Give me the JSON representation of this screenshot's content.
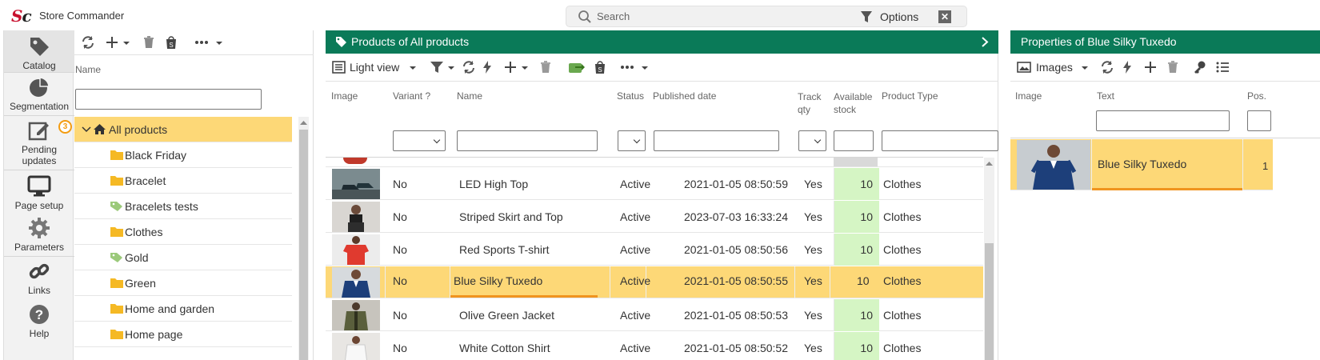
{
  "app": {
    "logo_s": "S",
    "logo_c": "c",
    "title": "Store Commander"
  },
  "search": {
    "placeholder": "Search",
    "options_label": "Options",
    "close_glyph": "✕"
  },
  "nav": {
    "items": [
      {
        "label": "Catalog",
        "icon": "tag-icon"
      },
      {
        "label": "Segmentation",
        "icon": "pie-chart-icon"
      },
      {
        "label": "Pending updates",
        "line1": "Pending",
        "line2": "updates",
        "icon": "edit-icon",
        "badge": "3"
      },
      {
        "label": "Page setup",
        "icon": "monitor-icon"
      },
      {
        "label": "Parameters",
        "icon": "gear-icon"
      },
      {
        "label": "Links",
        "icon": "link-icon"
      },
      {
        "label": "Help",
        "icon": "help-icon"
      }
    ]
  },
  "categories": {
    "column_header": "Name",
    "root": "All products",
    "items": [
      {
        "label": "Black Friday",
        "icon": "folder-icon"
      },
      {
        "label": "Bracelet",
        "icon": "folder-icon"
      },
      {
        "label": "Bracelets tests",
        "icon": "tag-icon"
      },
      {
        "label": "Clothes",
        "icon": "folder-icon"
      },
      {
        "label": "Gold",
        "icon": "tag-icon"
      },
      {
        "label": "Green",
        "icon": "folder-icon"
      },
      {
        "label": "Home and garden",
        "icon": "folder-icon"
      },
      {
        "label": "Home page",
        "icon": "folder-icon"
      }
    ]
  },
  "products": {
    "title": "Products of All products",
    "view_label": "Light view",
    "columns": {
      "image": "Image",
      "variant": "Variant ?",
      "name": "Name",
      "status": "Status",
      "published": "Published date",
      "track_l1": "Track",
      "track_l2": "qty",
      "stock_l1": "Available",
      "stock_l2": "stock",
      "type": "Product Type"
    },
    "rows": [
      {
        "variant": "No",
        "name": "LED High Top",
        "status": "Active",
        "published": "2021-01-05 08:50:59",
        "track": "Yes",
        "stock": "10",
        "type": "Clothes",
        "selected": false
      },
      {
        "variant": "No",
        "name": "Striped Skirt and Top",
        "status": "Active",
        "published": "2023-07-03 16:33:24",
        "track": "Yes",
        "stock": "10",
        "type": "Clothes",
        "selected": false
      },
      {
        "variant": "No",
        "name": "Red Sports T-shirt",
        "status": "Active",
        "published": "2021-01-05 08:50:56",
        "track": "Yes",
        "stock": "10",
        "type": "Clothes",
        "selected": false
      },
      {
        "variant": "No",
        "name": "Blue Silky Tuxedo",
        "status": "Active",
        "published": "2021-01-05 08:50:55",
        "track": "Yes",
        "stock": "10",
        "type": "Clothes",
        "selected": true
      },
      {
        "variant": "No",
        "name": "Olive Green Jacket",
        "status": "Active",
        "published": "2021-01-05 08:50:53",
        "track": "Yes",
        "stock": "10",
        "type": "Clothes",
        "selected": false
      },
      {
        "variant": "No",
        "name": "White Cotton Shirt",
        "status": "Active",
        "published": "2021-01-05 08:50:52",
        "track": "Yes",
        "stock": "10",
        "type": "Clothes",
        "selected": false
      }
    ]
  },
  "properties": {
    "title": "Properties of Blue Silky Tuxedo",
    "view_label": "Images",
    "columns": {
      "image": "Image",
      "text": "Text",
      "pos": "Pos."
    },
    "rows": [
      {
        "text": "Blue Silky Tuxedo",
        "pos": "1"
      }
    ]
  },
  "colors": {
    "accent_green": "#0a7a58",
    "selection": "#fdd877",
    "stock_bg": "#d5f5c4",
    "orange": "#f0941f",
    "brand_red": "#c8102e"
  }
}
